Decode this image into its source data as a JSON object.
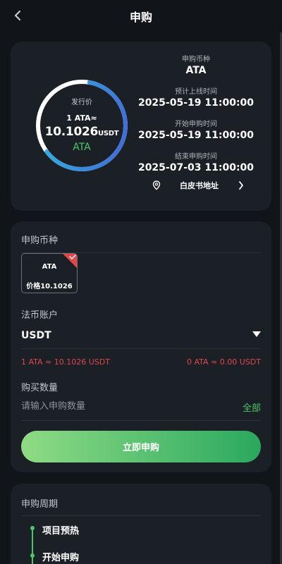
{
  "header": {
    "title": "申购"
  },
  "summary": {
    "ring_label": "发行价",
    "ring_rate": "1 ATA≈",
    "ring_price": "10.1026",
    "ring_price_unit": "USDT",
    "ring_coin": "ATA",
    "ring_progress": 0.62,
    "info": [
      {
        "label": "申购币种",
        "value": "ATA"
      },
      {
        "label": "预计上线时间",
        "value": "2025-05-19 11:00:00"
      },
      {
        "label": "开始申购时间",
        "value": "2025-05-19 11:00:00"
      },
      {
        "label": "结束申购时间",
        "value": "2025-07-03 11:00:00"
      }
    ],
    "whitepaper_label": "白皮书地址"
  },
  "form": {
    "coin_section_label": "申购币种",
    "coin_tile": {
      "name": "ATA",
      "price": "价格10.1026"
    },
    "account_label": "法币账户",
    "account_value": "USDT",
    "rate_left": "1 ATA ≈ 10.1026 USDT",
    "rate_right": "0 ATA ≈ 0.00 USDT",
    "qty_label": "购买数量",
    "qty_placeholder": "请输入申购数量",
    "qty_value": "",
    "all_label": "全部",
    "submit_label": "立即申购"
  },
  "cycle": {
    "title": "申购周期",
    "steps": [
      "项目预热",
      "开始申购"
    ]
  },
  "colors": {
    "accent_green": "#4cc86a",
    "alert_red": "#e1464a",
    "ring_blue": "#2fa6d9",
    "card_bg": "#1b1f26",
    "page_bg": "#111418"
  }
}
